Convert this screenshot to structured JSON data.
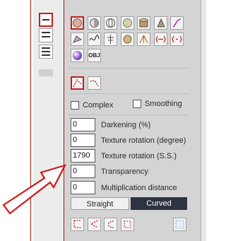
{
  "colors": {
    "accent_red": "#c02020",
    "panel_bg": "#d4d4d4",
    "segment_active": "#2d3340"
  },
  "icons": {
    "row1": [
      "sphere-shaded-icon",
      "sphere-half-icon",
      "sphere-wire-icon",
      "sphere-light-icon",
      "cylinder-icon",
      "cone-icon",
      "curve-icon"
    ],
    "row2": [
      "deform-icon",
      "wave-icon",
      "tree-icon",
      "ball-icon",
      "tripod-icon",
      "arrows-out-icon",
      "arrows-in-icon"
    ],
    "row3": [
      "gradient-sphere-icon"
    ],
    "obj_label": "OBJ"
  },
  "options": {
    "complex_label": "Complex",
    "smoothing_label": "Smoothing"
  },
  "fields": [
    {
      "value": "0",
      "label": "Darkening (%)"
    },
    {
      "value": "0",
      "label": "Texture rotation (degree)"
    },
    {
      "value": "1790",
      "label": "Texture rotation (S.S.)"
    },
    {
      "value": "0",
      "label": "Transparency"
    },
    {
      "value": "0",
      "label": "Multiplication distance"
    }
  ],
  "segments": {
    "straight_label": "Straight",
    "curved_label": "Curved",
    "selected": "Curved"
  }
}
